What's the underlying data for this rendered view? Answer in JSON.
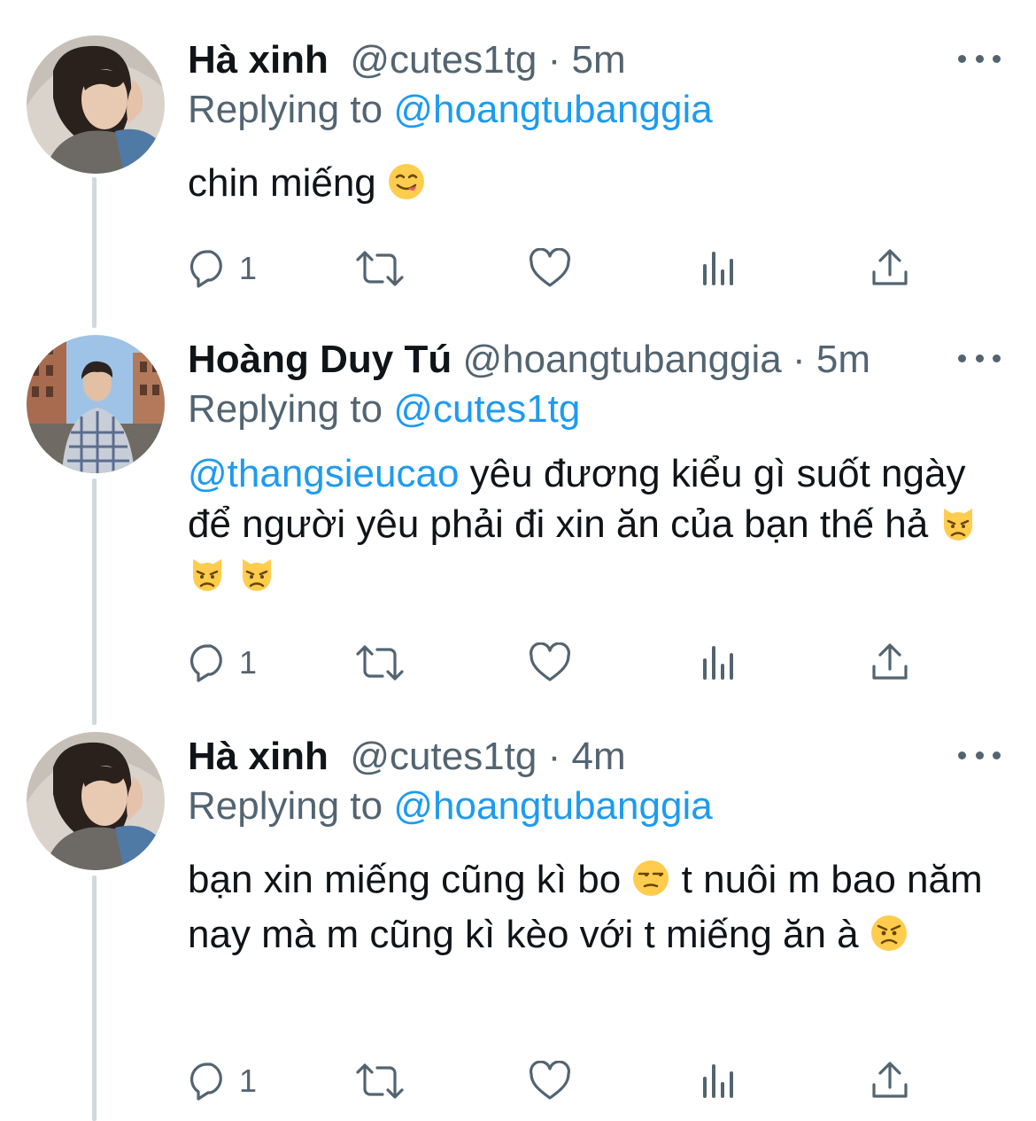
{
  "tweets": [
    {
      "name": "Hà xinh",
      "handle": "@cutes1tg",
      "sep": "·",
      "time": "5m",
      "replying_prefix": "Replying to",
      "replying_to": "@hoangtubanggia",
      "text": "chin miếng",
      "emojis": [
        "yum-emoji"
      ],
      "reply_count": "1",
      "avatar_icon": "avatar-ha-xinh"
    },
    {
      "name": "Hoàng Duy Tú",
      "handle": "@hoangtubanggia",
      "sep": "·",
      "time": "5m",
      "replying_prefix": "Replying to",
      "replying_to": "@cutes1tg",
      "mention": "@thangsieucao",
      "text_part1": " yêu đương kiểu gì suốt ngày để người yêu phải đi xin ăn của bạn thế hả",
      "emojis": [
        "pouting-cat-emoji",
        "pouting-cat-emoji",
        "pouting-cat-emoji"
      ],
      "reply_count": "1",
      "avatar_icon": "avatar-hoang-duy-tu"
    },
    {
      "name": "Hà xinh",
      "handle": "@cutes1tg",
      "sep": "·",
      "time": "4m",
      "replying_prefix": "Replying to",
      "replying_to": "@hoangtubanggia",
      "text_part1": "bạn xin miếng cũng kì bo",
      "text_part2": "  t nuôi m bao năm nay mà m cũng kì kèo với t miếng ăn à",
      "emojis": [
        "unamused-emoji",
        "angry-emoji"
      ],
      "reply_count": "1",
      "avatar_icon": "avatar-ha-xinh"
    }
  ],
  "colors": {
    "link": "#1d9bf0",
    "secondary": "#536471",
    "primary": "#0f1419",
    "thread_line": "#cfd9de"
  },
  "action_icons": [
    "reply-icon",
    "retweet-icon",
    "like-icon",
    "analytics-icon",
    "share-icon"
  ]
}
